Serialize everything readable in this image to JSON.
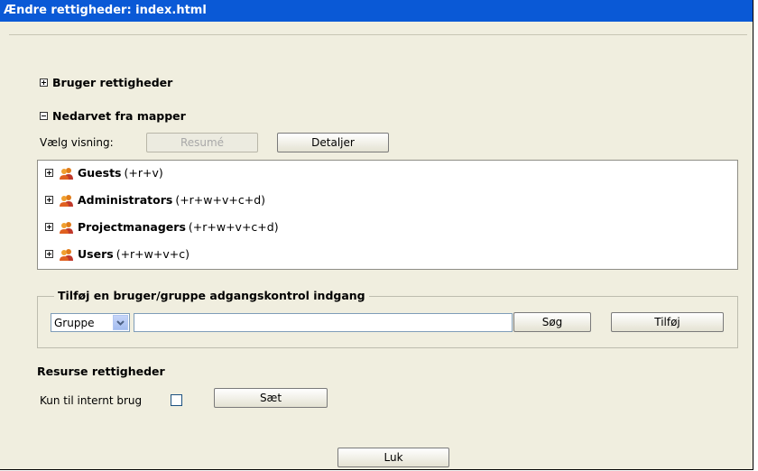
{
  "dialog": {
    "title": "Ændre rettigheder: index.html"
  },
  "sections": {
    "user_rights": "Bruger rettigheder",
    "inherited": "Nedarvet fra mapper"
  },
  "view_select": {
    "label": "Vælg visning:",
    "summary_button": "Resumé",
    "details_button": "Detaljer"
  },
  "groups": [
    {
      "name": "Guests",
      "perms": "(+r+v)"
    },
    {
      "name": "Administrators",
      "perms": "(+r+w+v+c+d)"
    },
    {
      "name": "Projectmanagers",
      "perms": "(+r+w+v+c+d)"
    },
    {
      "name": "Users",
      "perms": "(+r+w+v+c)"
    }
  ],
  "add_entry": {
    "legend": "Tilføj en bruger/gruppe adgangskontrol indgang",
    "type_selected": "Gruppe",
    "input_value": "",
    "search_button": "Søg",
    "add_button": "Tilføj"
  },
  "resource_rights": {
    "heading": "Resurse rettigheder",
    "internal_label": "Kun til internt brug",
    "internal_checked": false,
    "set_button": "Sæt"
  },
  "close_button": "Luk",
  "colors": {
    "titlebar": "#0a59d6",
    "panel": "#f0eedf"
  }
}
